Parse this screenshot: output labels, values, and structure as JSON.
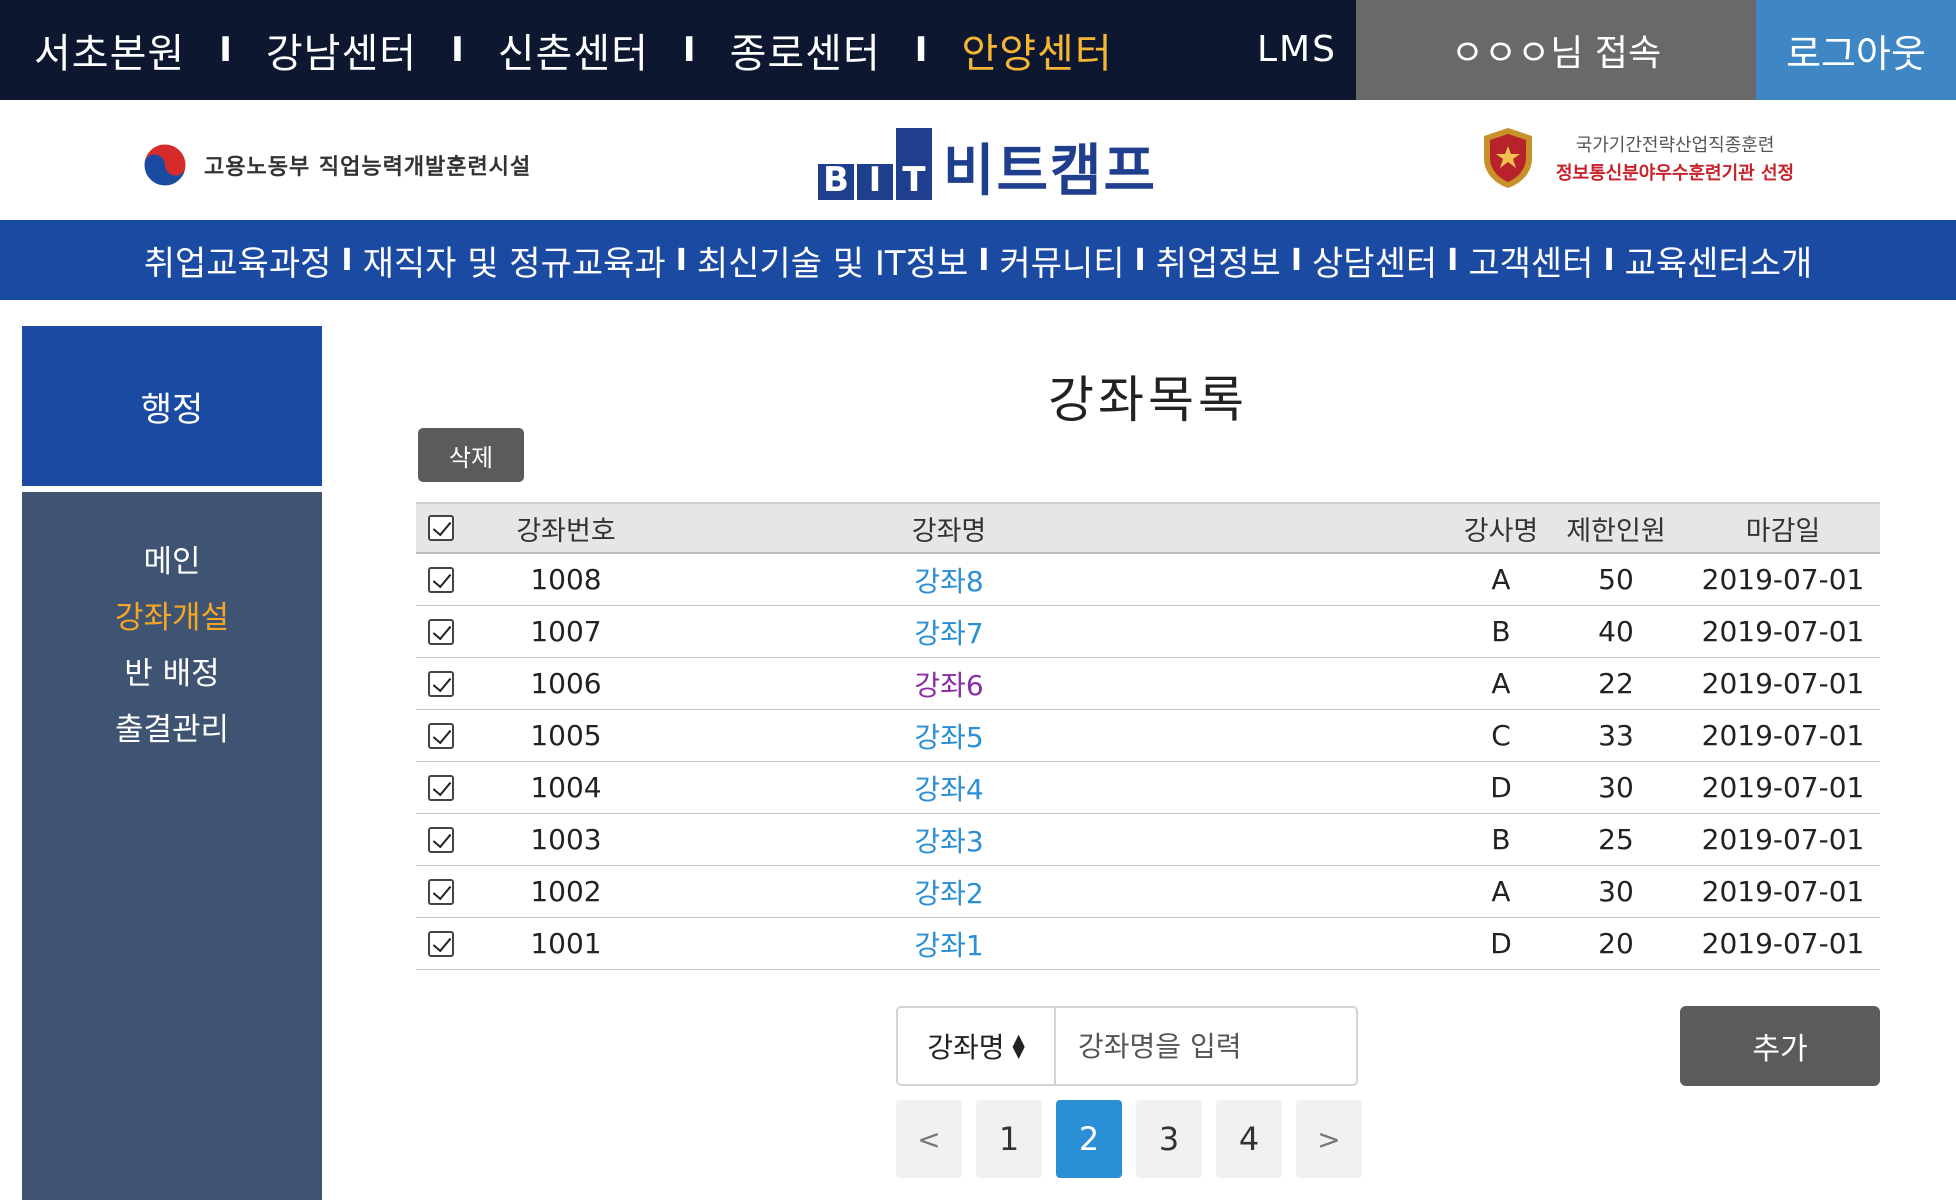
{
  "topbar": {
    "centers": [
      {
        "label": "서초본원",
        "active": false
      },
      {
        "label": "강남센터",
        "active": false
      },
      {
        "label": "신촌센터",
        "active": false
      },
      {
        "label": "종로센터",
        "active": false
      },
      {
        "label": "안양센터",
        "active": true
      }
    ],
    "separator": "I",
    "lms": "LMS",
    "user": "ㅇㅇㅇ님 접속",
    "logout": "로그아웃"
  },
  "logos": {
    "ministry": "고용노동부  직업능력개발훈련시설",
    "bit_mark": [
      "B",
      "I",
      "T"
    ],
    "bit_name": "비트캠프",
    "award_line1": "국가기간전략산업직종훈련",
    "award_line2": "정보통신분야우수훈련기관 선정"
  },
  "mainnav": {
    "items": [
      "취업교육과정",
      "재직자 및 정규교육과",
      "최신기술 및 IT정보",
      "커뮤니티",
      "취업정보",
      "상담센터",
      "고객센터",
      "교육센터소개"
    ],
    "separator": "I"
  },
  "sidebar": {
    "heading": "행정",
    "items": [
      {
        "label": "메인",
        "active": false
      },
      {
        "label": "강좌개설",
        "active": true
      },
      {
        "label": "반 배정",
        "active": false
      },
      {
        "label": "출결관리",
        "active": false
      }
    ]
  },
  "content": {
    "title": "강좌목록",
    "delete_label": "삭제",
    "table": {
      "headers": {
        "number": "강좌번호",
        "name": "강좌명",
        "teacher": "강사명",
        "limit": "제한인원",
        "deadline": "마감일"
      },
      "rows": [
        {
          "number": "1008",
          "name": "강좌8",
          "teacher": "A",
          "limit": "50",
          "deadline": "2019-07-01",
          "visited": false
        },
        {
          "number": "1007",
          "name": "강좌7",
          "teacher": "B",
          "limit": "40",
          "deadline": "2019-07-01",
          "visited": false
        },
        {
          "number": "1006",
          "name": "강좌6",
          "teacher": "A",
          "limit": "22",
          "deadline": "2019-07-01",
          "visited": true
        },
        {
          "number": "1005",
          "name": "강좌5",
          "teacher": "C",
          "limit": "33",
          "deadline": "2019-07-01",
          "visited": false
        },
        {
          "number": "1004",
          "name": "강좌4",
          "teacher": "D",
          "limit": "30",
          "deadline": "2019-07-01",
          "visited": false
        },
        {
          "number": "1003",
          "name": "강좌3",
          "teacher": "B",
          "limit": "25",
          "deadline": "2019-07-01",
          "visited": false
        },
        {
          "number": "1002",
          "name": "강좌2",
          "teacher": "A",
          "limit": "30",
          "deadline": "2019-07-01",
          "visited": false
        },
        {
          "number": "1001",
          "name": "강좌1",
          "teacher": "D",
          "limit": "20",
          "deadline": "2019-07-01",
          "visited": false
        }
      ]
    },
    "search": {
      "field_selected": "강좌명",
      "placeholder": "강좌명을 입력",
      "value": ""
    },
    "add_label": "추가",
    "pagination": {
      "prev": "<",
      "next": ">",
      "pages": [
        "1",
        "2",
        "3",
        "4"
      ],
      "current": "2"
    }
  },
  "colors": {
    "topbar_bg": "#0d1730",
    "active_center": "#f5b733",
    "nav_blue": "#1b4aa3",
    "sidebar_bg": "#3f5473",
    "sidebar_active": "#f5a623",
    "link_blue": "#2b8fd6",
    "link_visited": "#8a2ea5",
    "logout_bg": "#3f86c5",
    "user_bg": "#696969"
  }
}
